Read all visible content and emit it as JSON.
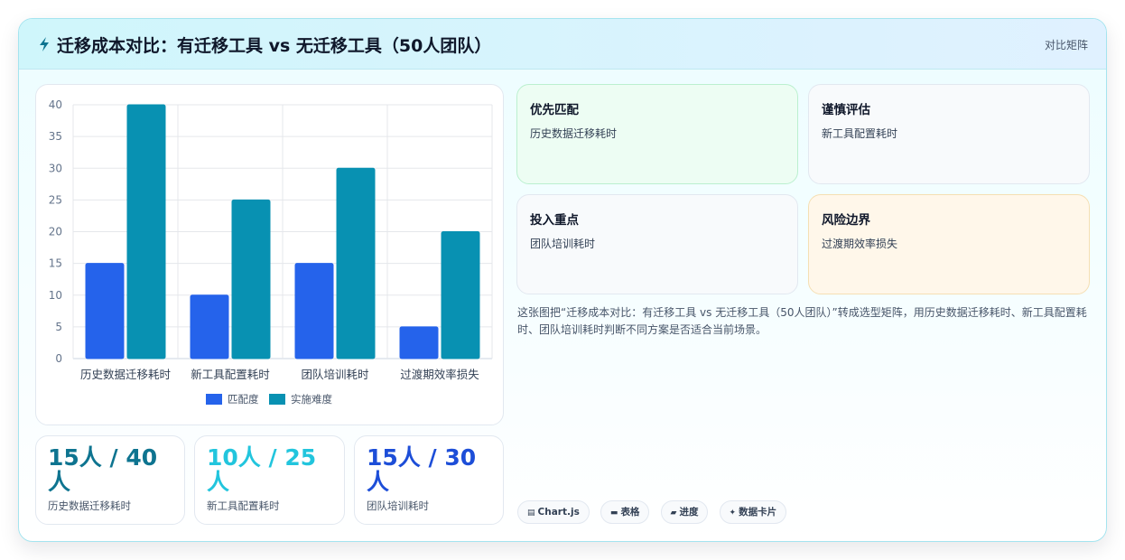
{
  "header": {
    "title": "迁移成本对比：有迁移工具 vs 无迁移工具（50人团队）",
    "tag": "对比矩阵"
  },
  "chart_data": {
    "type": "bar",
    "title": "",
    "xlabel": "",
    "ylabel": "",
    "categories": [
      "历史数据迁移耗时",
      "新工具配置耗时",
      "团队培训耗时",
      "过渡期效率损失"
    ],
    "series": [
      {
        "name": "匹配度",
        "values": [
          15,
          10,
          15,
          5
        ],
        "color": "#2563eb"
      },
      {
        "name": "实施难度",
        "values": [
          40,
          25,
          30,
          20
        ],
        "color": "#0891b2"
      }
    ],
    "ylim": [
      0,
      40
    ],
    "yticks": [
      "0",
      "5",
      "10",
      "15",
      "20",
      "25",
      "30",
      "35",
      "40"
    ],
    "grid": true,
    "legend": "bottom"
  },
  "kpis": [
    {
      "value": "15人 / 40人",
      "label": "历史数据迁移耗时",
      "color": "#0e7490"
    },
    {
      "value": "10人 / 25人",
      "label": "新工具配置耗时",
      "color": "#22c5dd"
    },
    {
      "value": "15人 / 30人",
      "label": "团队培训耗时",
      "color": "#1d4ed8"
    }
  ],
  "tiles": [
    {
      "title": "优先匹配",
      "subtitle": "历史数据迁移耗时"
    },
    {
      "title": "谨慎评估",
      "subtitle": "新工具配置耗时"
    },
    {
      "title": "投入重点",
      "subtitle": "团队培训耗时"
    },
    {
      "title": "风险边界",
      "subtitle": "过渡期效率损失"
    }
  ],
  "description": "这张图把“迁移成本对比：有迁移工具 vs 无迁移工具（50人团队）”转成选型矩阵，用历史数据迁移耗时、新工具配置耗时、团队培训耗时判断不同方案是否适合当前场景。",
  "chips": [
    {
      "icon": "▤",
      "label": "Chart.js"
    },
    {
      "icon": "▬",
      "label": "表格"
    },
    {
      "icon": "▰",
      "label": "进度"
    },
    {
      "icon": "✦",
      "label": "数据卡片"
    }
  ],
  "colors": {
    "accent": "#0891b2",
    "primary": "#2563eb"
  }
}
